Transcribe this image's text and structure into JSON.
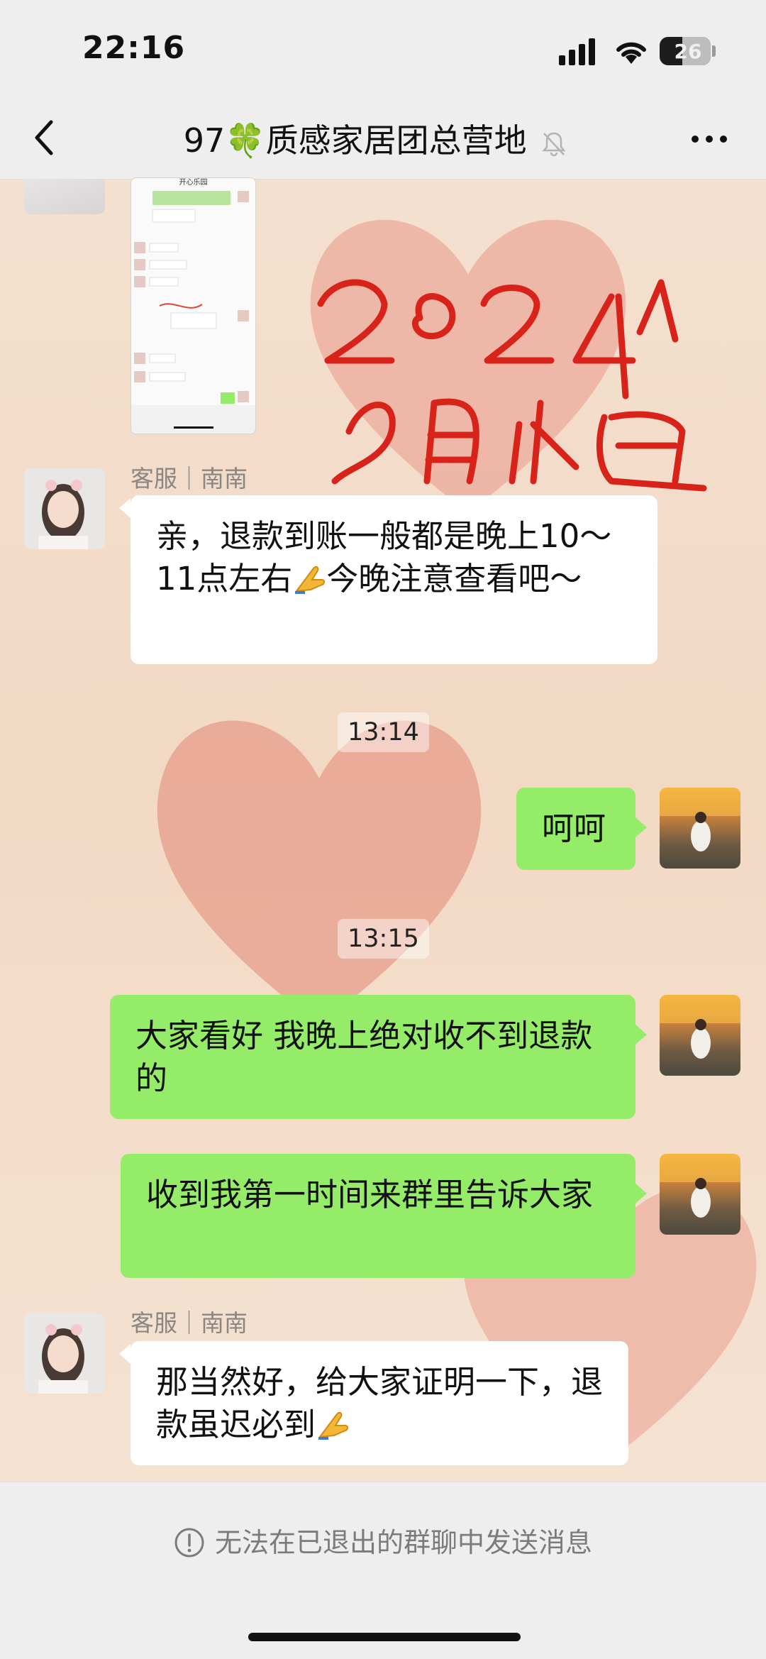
{
  "status_bar": {
    "time": "22:16",
    "battery": "26"
  },
  "nav": {
    "title": "97🍀质感家居团总营地"
  },
  "messages": [
    {
      "sender": "客服｜南南",
      "text": "亲，退款到账一般都是晚上10～11点左右",
      "text2": "今晚注意查看吧～"
    },
    {
      "timestamp": "13:14"
    },
    {
      "text": "呵呵"
    },
    {
      "timestamp": "13:15"
    },
    {
      "text": "大家看好 我晚上绝对收不到退款的"
    },
    {
      "text": "收到我第一时间来群里告诉大家"
    },
    {
      "sender": "客服｜南南",
      "text": "那当然好，给大家证明一下，退款虽迟必到"
    }
  ],
  "thumbnail": {
    "title": "开心乐园"
  },
  "footer": {
    "notice": "无法在已退出的群聊中发送消息"
  },
  "colors": {
    "bubble_self": "#95ec69",
    "bubble_other": "#ffffff",
    "annotation": "#d8231b"
  },
  "icons": [
    "back-icon",
    "mute-icon",
    "more-icon",
    "info-icon",
    "pray-emoji"
  ]
}
